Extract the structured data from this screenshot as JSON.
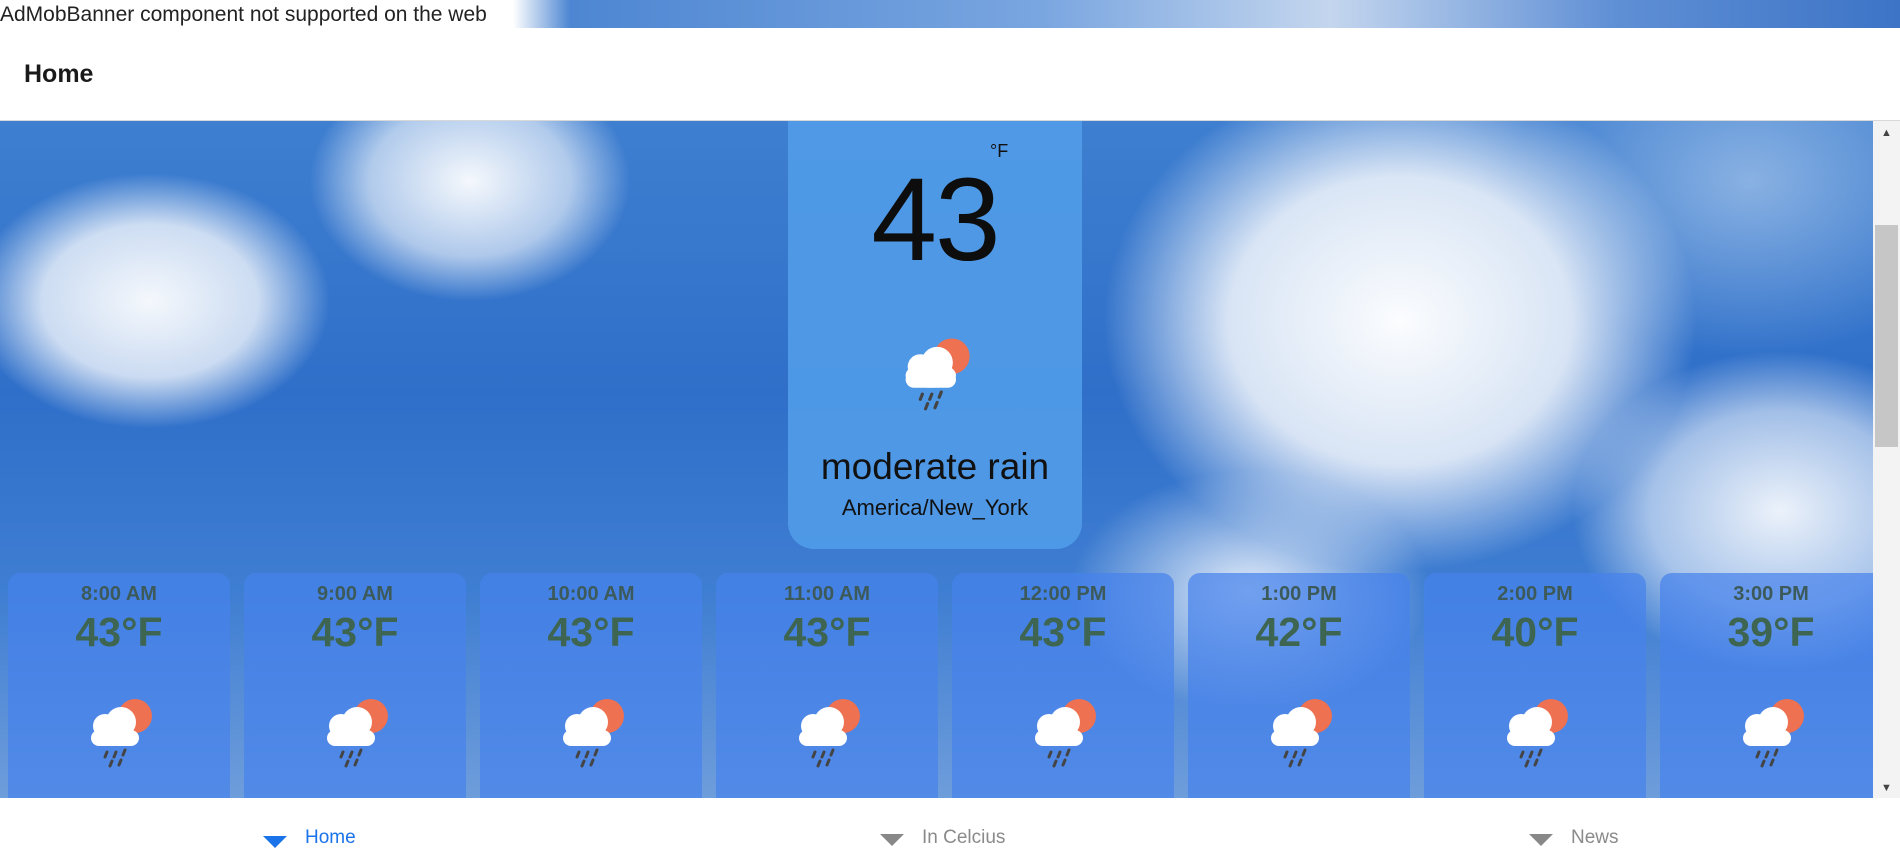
{
  "admob": {
    "text": "AdMobBanner component not supported on the web"
  },
  "header": {
    "title": "Home"
  },
  "current": {
    "unit": "°F",
    "temperature": "43",
    "icon": "cloud-rain-sun-icon",
    "condition": "moderate rain",
    "location": "America/New_York"
  },
  "hourly": [
    {
      "time": "8:00 AM",
      "temp": "43°F",
      "icon": "cloud-rain-sun-icon"
    },
    {
      "time": "9:00 AM",
      "temp": "43°F",
      "icon": "cloud-rain-sun-icon"
    },
    {
      "time": "10:00 AM",
      "temp": "43°F",
      "icon": "cloud-rain-sun-icon"
    },
    {
      "time": "11:00 AM",
      "temp": "43°F",
      "icon": "cloud-rain-sun-icon"
    },
    {
      "time": "12:00 PM",
      "temp": "43°F",
      "icon": "cloud-rain-sun-icon"
    },
    {
      "time": "1:00 PM",
      "temp": "42°F",
      "icon": "cloud-rain-sun-icon"
    },
    {
      "time": "2:00 PM",
      "temp": "40°F",
      "icon": "cloud-rain-sun-icon"
    },
    {
      "time": "3:00 PM",
      "temp": "39°F",
      "icon": "cloud-rain-sun-icon"
    }
  ],
  "tabs": [
    {
      "label": "Home",
      "active": true
    },
    {
      "label": "In Celcius",
      "active": false
    },
    {
      "label": "News",
      "active": false
    }
  ],
  "colors": {
    "accent": "#1a73e8",
    "card": "#509be8",
    "hour_temp": "#3e6552"
  }
}
